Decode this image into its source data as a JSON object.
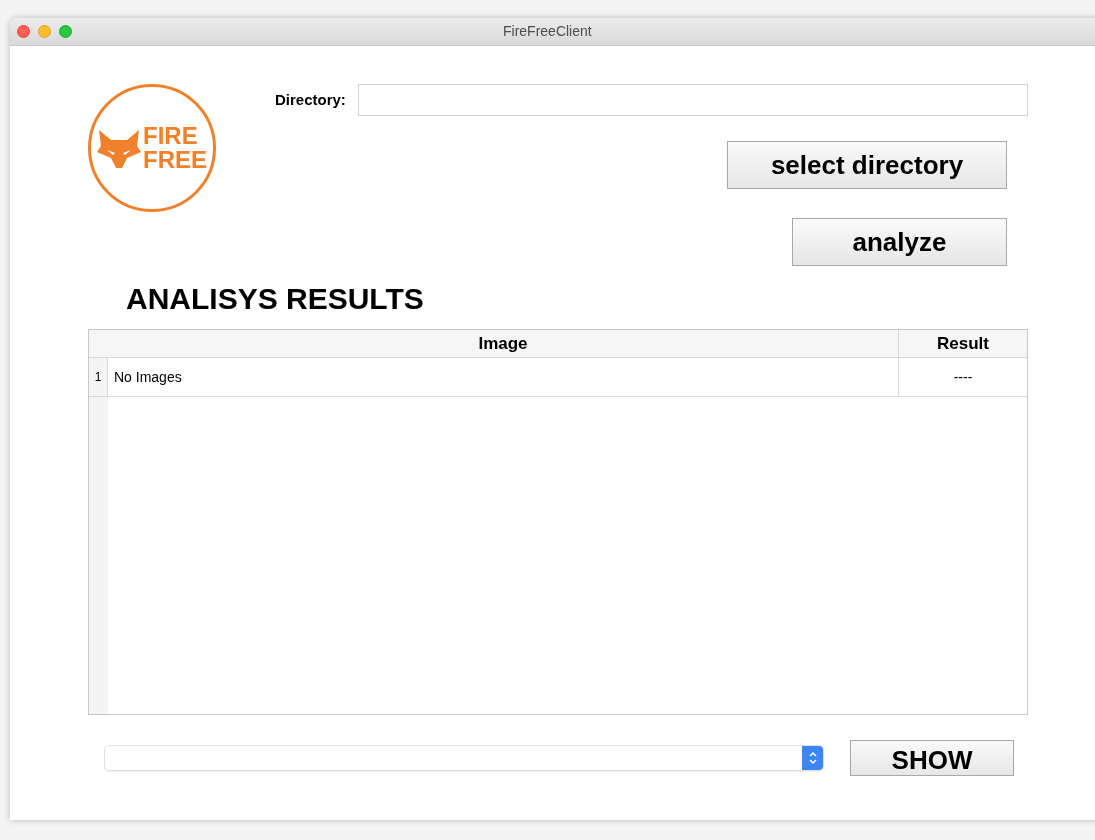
{
  "window": {
    "title": "FireFreeClient"
  },
  "logo": {
    "lines": [
      "FIRE",
      "FREE"
    ]
  },
  "directory": {
    "label": "Directory:"
  },
  "buttons": {
    "select_directory": "select directory",
    "analyze": "analyze",
    "show": "SHOW"
  },
  "heading": "ANALISYS RESULTS",
  "table": {
    "columns": [
      "Image",
      "Result"
    ],
    "rows": [
      {
        "number": "1",
        "image": "No Images",
        "result": "----"
      }
    ]
  }
}
